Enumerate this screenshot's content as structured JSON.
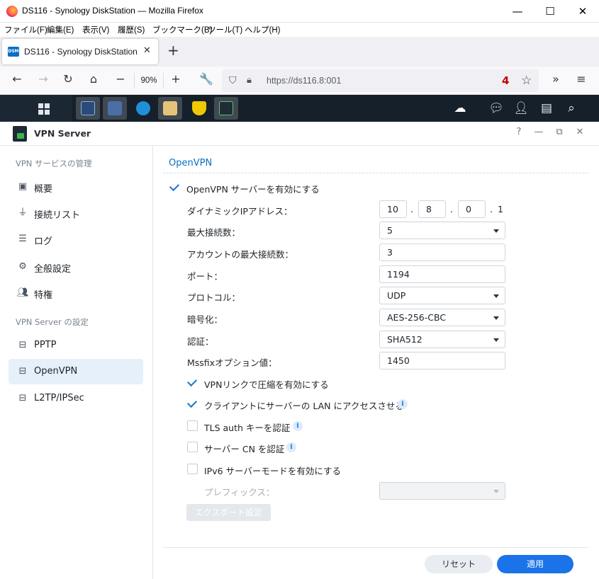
{
  "browser": {
    "window_title": "DS116 - Synology DiskStation — Mozilla Firefox",
    "menu": [
      "ファイル(F)",
      "編集(E)",
      "表示(V)",
      "履歴(S)",
      "ブックマーク(B)",
      "ツール(T)",
      "ヘルプ(H)"
    ],
    "tab_favicon": "DSM",
    "tab_title": "DS116 - Synology DiskStation",
    "zoom": "90%",
    "url": "https://ds116.8:001",
    "notification_count": "4"
  },
  "dsm_taskbar": {
    "apps": [
      "main-menu",
      "resource-monitor",
      "storage-manager",
      "web-station",
      "package-center",
      "security-advisor",
      "vpn-server"
    ],
    "active_app": "vpn-server"
  },
  "window": {
    "title": "VPN Server",
    "controls": [
      "?",
      "—",
      "⧉",
      "✕"
    ]
  },
  "sidebar": {
    "section1": "VPN サービスの管理",
    "items1": [
      {
        "label": "概要",
        "icon": "overview-icon"
      },
      {
        "label": "接続リスト",
        "icon": "plug-icon"
      },
      {
        "label": "ログ",
        "icon": "list-icon"
      },
      {
        "label": "全般設定",
        "icon": "gear-icon"
      },
      {
        "label": "特権",
        "icon": "users-icon"
      }
    ],
    "section2": "VPN Server の設定",
    "items2": [
      {
        "label": "PPTP",
        "icon": "network-icon"
      },
      {
        "label": "OpenVPN",
        "icon": "network-icon",
        "selected": true
      },
      {
        "label": "L2TP/IPSec",
        "icon": "network-icon"
      }
    ]
  },
  "main": {
    "section_title": "OpenVPN",
    "enable_label": "OpenVPN サーバーを有効にする",
    "enable_checked": true,
    "fields": {
      "dynamic_ip_label": "ダイナミックIPアドレス：",
      "ip_octets": [
        "10",
        "8",
        "0",
        "1"
      ],
      "max_conn_label": "最大接続数：",
      "max_conn": "5",
      "max_conn_account_label": "アカウントの最大接続数：",
      "max_conn_account": "3",
      "port_label": "ポート：",
      "port": "1194",
      "protocol_label": "プロトコル：",
      "protocol": "UDP",
      "encryption_label": "暗号化：",
      "encryption": "AES-256-CBC",
      "auth_label": "認証：",
      "auth": "SHA512",
      "mssfix_label": "Mssfixオプション値：",
      "mssfix": "1450"
    },
    "options": {
      "compression": "VPNリンクで圧縮を有効にする",
      "lan_access": "クライアントにサーバーの LAN にアクセスさせる",
      "tls_auth": "TLS auth キーを認証",
      "server_cn": "サーバー CN を認証",
      "ipv6": "IPv6 サーバーモードを有効にする",
      "prefix_label": "プレフィックス："
    },
    "export_button": "エクスポート設定",
    "reset_button": "リセット",
    "apply_button": "適用"
  },
  "colors": {
    "accent": "#1a73e8",
    "taskbar": "#16202b",
    "selected_bg": "#e6f0fb"
  }
}
